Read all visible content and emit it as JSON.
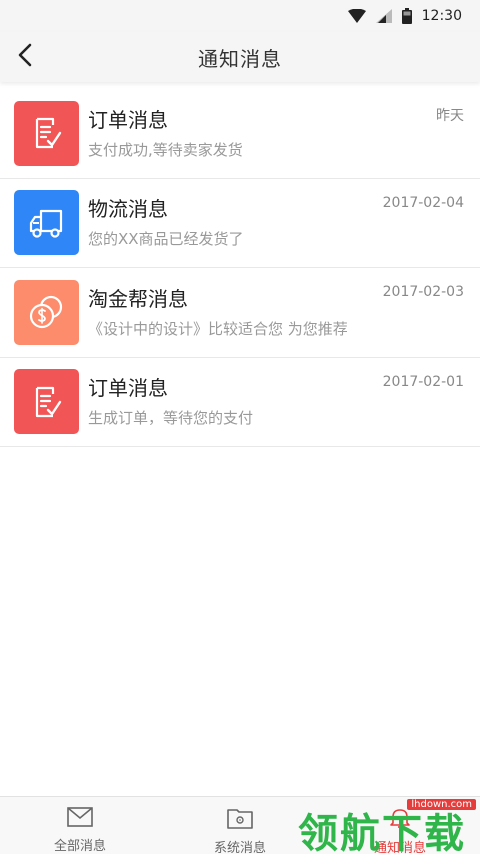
{
  "status_bar": {
    "time": "12:30"
  },
  "header": {
    "title": "通知消息"
  },
  "messages": [
    {
      "title": "订单消息",
      "subtitle": "支付成功,等待卖家发货",
      "time": "昨天",
      "icon": "order-doc-icon",
      "color": "#f25555"
    },
    {
      "title": "物流消息",
      "subtitle": "您的XX商品已经发货了",
      "time": "2017-02-04",
      "icon": "truck-icon",
      "color": "#2f86f6"
    },
    {
      "title": "淘金帮消息",
      "subtitle": "《设计中的设计》比较适合您 为您推荐",
      "time": "2017-02-03",
      "icon": "coins-icon",
      "color": "#fc8c6b"
    },
    {
      "title": "订单消息",
      "subtitle": "生成订单，等待您的支付",
      "time": "2017-02-01",
      "icon": "order-doc-icon",
      "color": "#f25555"
    }
  ],
  "tabs": [
    {
      "label": "全部消息",
      "icon": "envelope-icon"
    },
    {
      "label": "系统消息",
      "icon": "folder-gear-icon"
    },
    {
      "label": "通知消息",
      "icon": "bell-icon",
      "active": true
    }
  ],
  "watermark": {
    "text": "领航下载",
    "url": "lhdown.com"
  },
  "colors": {
    "accent": "#e63c3c",
    "divider": "#e8e8e8"
  }
}
